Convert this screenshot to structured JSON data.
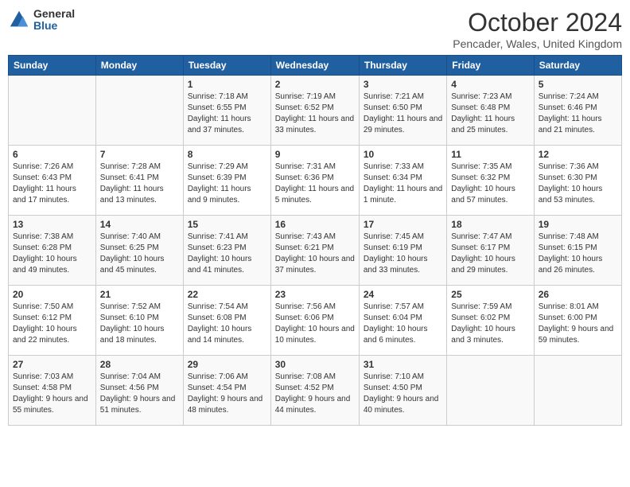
{
  "header": {
    "logo_general": "General",
    "logo_blue": "Blue",
    "month_title": "October 2024",
    "subtitle": "Pencader, Wales, United Kingdom"
  },
  "days_of_week": [
    "Sunday",
    "Monday",
    "Tuesday",
    "Wednesday",
    "Thursday",
    "Friday",
    "Saturday"
  ],
  "weeks": [
    [
      {
        "day": "",
        "info": ""
      },
      {
        "day": "",
        "info": ""
      },
      {
        "day": "1",
        "info": "Sunrise: 7:18 AM\nSunset: 6:55 PM\nDaylight: 11 hours and 37 minutes."
      },
      {
        "day": "2",
        "info": "Sunrise: 7:19 AM\nSunset: 6:52 PM\nDaylight: 11 hours and 33 minutes."
      },
      {
        "day": "3",
        "info": "Sunrise: 7:21 AM\nSunset: 6:50 PM\nDaylight: 11 hours and 29 minutes."
      },
      {
        "day": "4",
        "info": "Sunrise: 7:23 AM\nSunset: 6:48 PM\nDaylight: 11 hours and 25 minutes."
      },
      {
        "day": "5",
        "info": "Sunrise: 7:24 AM\nSunset: 6:46 PM\nDaylight: 11 hours and 21 minutes."
      }
    ],
    [
      {
        "day": "6",
        "info": "Sunrise: 7:26 AM\nSunset: 6:43 PM\nDaylight: 11 hours and 17 minutes."
      },
      {
        "day": "7",
        "info": "Sunrise: 7:28 AM\nSunset: 6:41 PM\nDaylight: 11 hours and 13 minutes."
      },
      {
        "day": "8",
        "info": "Sunrise: 7:29 AM\nSunset: 6:39 PM\nDaylight: 11 hours and 9 minutes."
      },
      {
        "day": "9",
        "info": "Sunrise: 7:31 AM\nSunset: 6:36 PM\nDaylight: 11 hours and 5 minutes."
      },
      {
        "day": "10",
        "info": "Sunrise: 7:33 AM\nSunset: 6:34 PM\nDaylight: 11 hours and 1 minute."
      },
      {
        "day": "11",
        "info": "Sunrise: 7:35 AM\nSunset: 6:32 PM\nDaylight: 10 hours and 57 minutes."
      },
      {
        "day": "12",
        "info": "Sunrise: 7:36 AM\nSunset: 6:30 PM\nDaylight: 10 hours and 53 minutes."
      }
    ],
    [
      {
        "day": "13",
        "info": "Sunrise: 7:38 AM\nSunset: 6:28 PM\nDaylight: 10 hours and 49 minutes."
      },
      {
        "day": "14",
        "info": "Sunrise: 7:40 AM\nSunset: 6:25 PM\nDaylight: 10 hours and 45 minutes."
      },
      {
        "day": "15",
        "info": "Sunrise: 7:41 AM\nSunset: 6:23 PM\nDaylight: 10 hours and 41 minutes."
      },
      {
        "day": "16",
        "info": "Sunrise: 7:43 AM\nSunset: 6:21 PM\nDaylight: 10 hours and 37 minutes."
      },
      {
        "day": "17",
        "info": "Sunrise: 7:45 AM\nSunset: 6:19 PM\nDaylight: 10 hours and 33 minutes."
      },
      {
        "day": "18",
        "info": "Sunrise: 7:47 AM\nSunset: 6:17 PM\nDaylight: 10 hours and 29 minutes."
      },
      {
        "day": "19",
        "info": "Sunrise: 7:48 AM\nSunset: 6:15 PM\nDaylight: 10 hours and 26 minutes."
      }
    ],
    [
      {
        "day": "20",
        "info": "Sunrise: 7:50 AM\nSunset: 6:12 PM\nDaylight: 10 hours and 22 minutes."
      },
      {
        "day": "21",
        "info": "Sunrise: 7:52 AM\nSunset: 6:10 PM\nDaylight: 10 hours and 18 minutes."
      },
      {
        "day": "22",
        "info": "Sunrise: 7:54 AM\nSunset: 6:08 PM\nDaylight: 10 hours and 14 minutes."
      },
      {
        "day": "23",
        "info": "Sunrise: 7:56 AM\nSunset: 6:06 PM\nDaylight: 10 hours and 10 minutes."
      },
      {
        "day": "24",
        "info": "Sunrise: 7:57 AM\nSunset: 6:04 PM\nDaylight: 10 hours and 6 minutes."
      },
      {
        "day": "25",
        "info": "Sunrise: 7:59 AM\nSunset: 6:02 PM\nDaylight: 10 hours and 3 minutes."
      },
      {
        "day": "26",
        "info": "Sunrise: 8:01 AM\nSunset: 6:00 PM\nDaylight: 9 hours and 59 minutes."
      }
    ],
    [
      {
        "day": "27",
        "info": "Sunrise: 7:03 AM\nSunset: 4:58 PM\nDaylight: 9 hours and 55 minutes."
      },
      {
        "day": "28",
        "info": "Sunrise: 7:04 AM\nSunset: 4:56 PM\nDaylight: 9 hours and 51 minutes."
      },
      {
        "day": "29",
        "info": "Sunrise: 7:06 AM\nSunset: 4:54 PM\nDaylight: 9 hours and 48 minutes."
      },
      {
        "day": "30",
        "info": "Sunrise: 7:08 AM\nSunset: 4:52 PM\nDaylight: 9 hours and 44 minutes."
      },
      {
        "day": "31",
        "info": "Sunrise: 7:10 AM\nSunset: 4:50 PM\nDaylight: 9 hours and 40 minutes."
      },
      {
        "day": "",
        "info": ""
      },
      {
        "day": "",
        "info": ""
      }
    ]
  ]
}
